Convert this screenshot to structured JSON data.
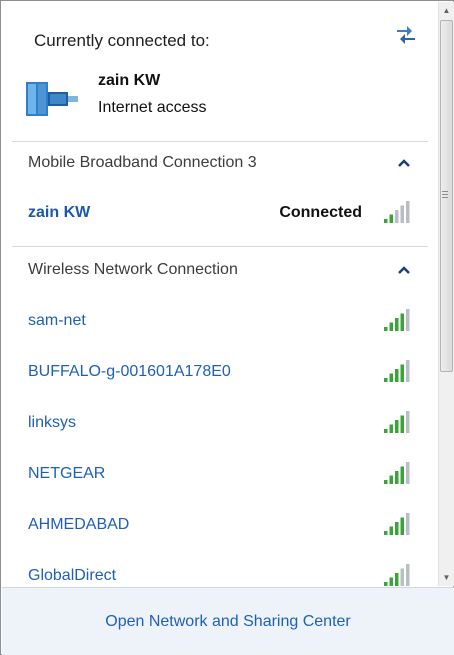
{
  "header": {
    "title": "Currently connected to:",
    "refresh_icon": "refresh-arrows-icon",
    "connection": {
      "name": "zain KW",
      "status": "Internet access",
      "icon": "network-icon"
    }
  },
  "sections": [
    {
      "title": "Mobile Broadband Connection 3",
      "expanded": true,
      "items": [
        {
          "name": "zain KW",
          "status": "Connected",
          "signal_bars": 2
        }
      ]
    },
    {
      "title": "Wireless Network Connection",
      "expanded": true,
      "items": [
        {
          "name": "sam-net",
          "signal_bars": 4
        },
        {
          "name": "BUFFALO-g-001601A178E0",
          "signal_bars": 4
        },
        {
          "name": "linksys",
          "signal_bars": 4
        },
        {
          "name": "NETGEAR",
          "signal_bars": 4
        },
        {
          "name": "AHMEDABAD",
          "signal_bars": 4
        },
        {
          "name": "GlobalDirect",
          "signal_bars": 3
        }
      ]
    }
  ],
  "footer": {
    "link_label": "Open Network and Sharing Center"
  },
  "colors": {
    "link": "#1f5fb8",
    "signal_green": "#3aa43a",
    "signal_gray": "#b9bec5",
    "footer_bg": "#eef3f9"
  }
}
